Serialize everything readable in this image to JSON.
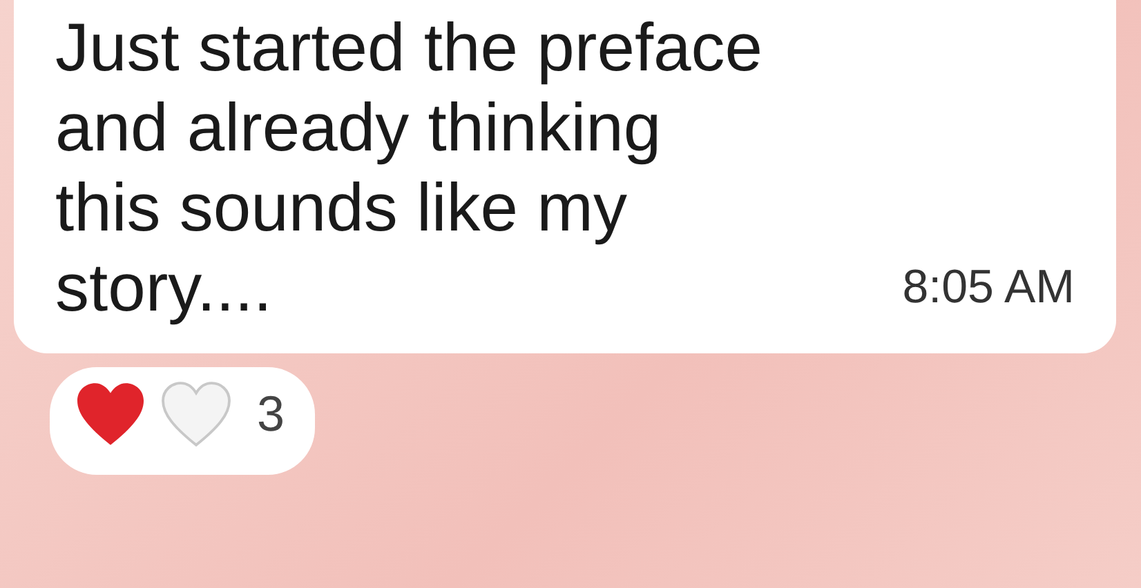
{
  "message": {
    "text": "Just started the preface\nand already thinking\nthis sounds like my\nstory....",
    "time": "8:05 AM"
  },
  "reactions": {
    "count": "3"
  }
}
